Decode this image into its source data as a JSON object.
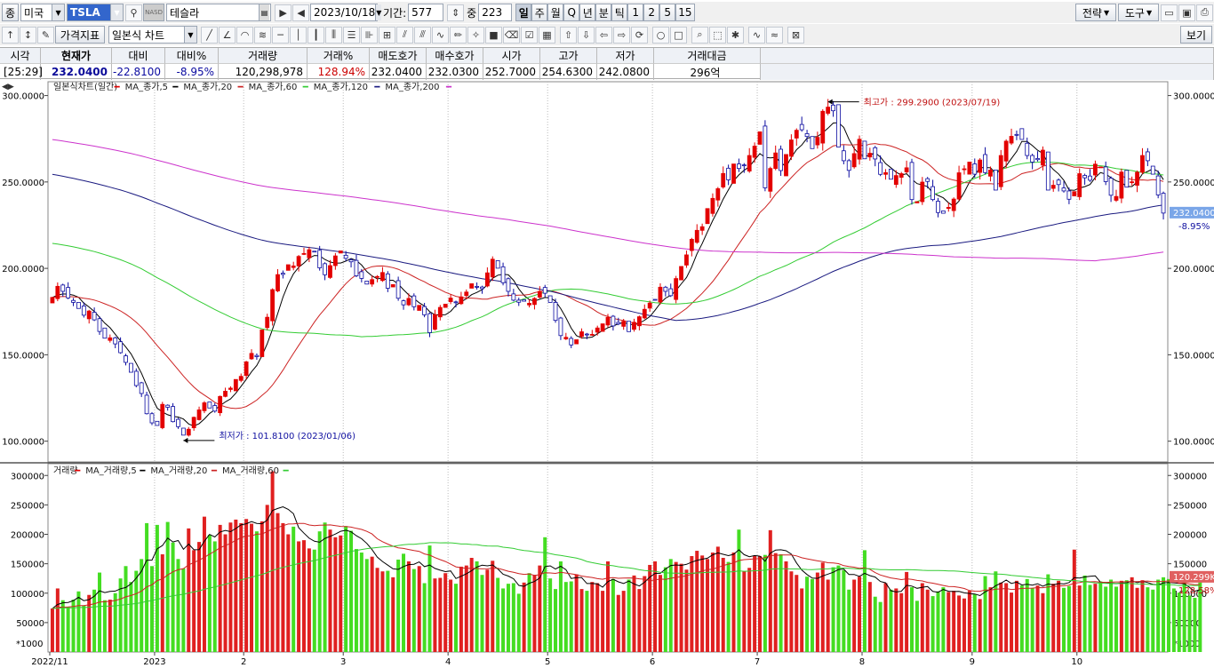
{
  "toolbar1": {
    "market_label": "종",
    "market": "미국",
    "ticker": "TSLA",
    "exchange_badge": "NASD",
    "name": "테슬라",
    "date": "2023/10/18",
    "period_label": "기간:",
    "period": "577",
    "zoom_label": "중",
    "zoom": "223",
    "intervals": [
      "일",
      "주",
      "월",
      "Q",
      "년",
      "분",
      "틱",
      "1",
      "2",
      "5",
      "15"
    ],
    "right": [
      "전략",
      "도구"
    ]
  },
  "toolbar2": {
    "indicator_btn": "가격지표",
    "chart_type": "일본식 차트",
    "view_btn": "보기"
  },
  "quote": {
    "headers": [
      "시각",
      "현재가",
      "대비",
      "대비%",
      "거래량",
      "거래%",
      "매도호가",
      "매수호가",
      "시가",
      "고가",
      "저가",
      "거래대금"
    ],
    "values": [
      "[25:29]",
      "232.0400",
      "-22.8100",
      "-8.95%",
      "120,298,978",
      "128.94%",
      "232.0400",
      "232.0300",
      "252.7000",
      "254.6300",
      "242.0800",
      "296억"
    ]
  },
  "price_panel": {
    "legend": [
      "일본식차트(일간)",
      "MA_종가,5",
      "MA_종가,20",
      "MA_종가,60",
      "MA_종가,120",
      "MA_종가,200"
    ],
    "high_note": "최고가 : 299.2900 (2023/07/19)",
    "low_note": "최저가 : 101.8100 (2023/01/06)",
    "last_price": "232.0400",
    "last_change": "-8.95%"
  },
  "volume_panel": {
    "legend": [
      "거래량",
      "MA_거래량,5",
      "MA_거래량,20",
      "MA_거래량,60"
    ],
    "last_volume": "120.299K",
    "last_ratio": "128.58%",
    "unit": "*1000"
  },
  "colors": {
    "up": "#e30000",
    "down": "#0a0aa0",
    "volume_up": "#e02020",
    "volume_down": "#44dd22",
    "ma5": "#000000",
    "ma20": "#cc2222",
    "ma60": "#33cc33",
    "ma120": "#1a1a80",
    "ma200": "#cc33cc"
  },
  "chart_data": [
    {
      "type": "candlestick",
      "title": "일본식차트(일간)",
      "x_labels": [
        "2022/11",
        "2023",
        "2",
        "3",
        "4",
        "5",
        "6",
        "7",
        "8",
        "9",
        "10"
      ],
      "y_ticks": [
        100,
        150,
        200,
        250,
        300
      ],
      "ylim": [
        88,
        308
      ],
      "series": [
        {
          "name": "TSLA daily close",
          "values": [
            183.2,
            189.6,
            186.7,
            182.9,
            180.3,
            176.8,
            172.9,
            175.3,
            170.2,
            163.5,
            159.6,
            159.8,
            156.3,
            151.2,
            145.6,
            139.9,
            132.2,
            127.6,
            115.9,
            110.6,
            109.1,
            121.3,
            119.6,
            111.3,
            108.4,
            103.5,
            106.9,
            113.8,
            118.1,
            122.2,
            119.2,
            117.4,
            125.9,
            128.9,
            130.7,
            135.7,
            137.5,
            145.9,
            150.8,
            148.9,
            164.4,
            171.7,
            187.7,
            196.4,
            196.5,
            202.1,
            201.4,
            206.9,
            208.6,
            210.8,
            209.6,
            200.3,
            196.3,
            201.6,
            207.2,
            210.1,
            205.8,
            203.8,
            195.7,
            194.2,
            190.9,
            193.5,
            195.3,
            197.6,
            188.5,
            190.6,
            182.7,
            178.9,
            182.6,
            177.8,
            178.6,
            173.1,
            162.8,
            173.3,
            177.4,
            179.3,
            182.8,
            180.3,
            183.5,
            186.3,
            191.1,
            189.2,
            188.3,
            197.4,
            205.3,
            200.1,
            191.7,
            186.7,
            181.6,
            180.4,
            181.0,
            179.8,
            182.6,
            186.7,
            185.6,
            180.3,
            169.9,
            161.1,
            160.1,
            155.7,
            158.7,
            163.3,
            161.6,
            161.8,
            165.5,
            167.9,
            171.6,
            166.7,
            167.8,
            169.4,
            163.4,
            168.8,
            172.0,
            176.3,
            179.9,
            182.0,
            189.1,
            186.7,
            184.2,
            194.1,
            201.1,
            207.8,
            216.8,
            222.0,
            224.1,
            234.6,
            240.5,
            246.1,
            254.9,
            251.2,
            260.4,
            257.8,
            259.4,
            265.3,
            270.7,
            279.0,
            246.6,
            257.8,
            266.8,
            256.6,
            265.9,
            274.3,
            279.9,
            280.2,
            276.3,
            269.3,
            275.8,
            290.9,
            293.3,
            291.2,
            270.2,
            262.3,
            256.7,
            266.4,
            274.7,
            263.4,
            266.6,
            263.3,
            254.4,
            255.4,
            251.6,
            253.7,
            254.8,
            258.2,
            239.8,
            238.6,
            249.9,
            250.3,
            239.8,
            232.3,
            231.9,
            235.3,
            240.1,
            255.3,
            257.6,
            261.5,
            254.5,
            262.7,
            255.4,
            256.9,
            245.3,
            265.3,
            273.6,
            276.4,
            277.5,
            274.6,
            265.3,
            261.5,
            262.9,
            268.4,
            245.3,
            248.1,
            248.5,
            244.8,
            240.0,
            244.4,
            254.8,
            252.4,
            251.0,
            260.3,
            258.7,
            250.2,
            242.3,
            241.6,
            255.7,
            247.0,
            250.1,
            255.6,
            265.3,
            262.3,
            254.5,
            242.5,
            232.0
          ]
        }
      ]
    },
    {
      "type": "bar",
      "title": "거래량",
      "y_ticks": [
        50000,
        100000,
        150000,
        200000,
        250000,
        300000
      ],
      "ylim": [
        0,
        320000
      ],
      "unit": "*1000",
      "series": [
        {
          "name": "거래량",
          "values": [
            74,
            108,
            88,
            77,
            89,
            103,
            79,
            97,
            106,
            135,
            88,
            89,
            100,
            125,
            146,
            119,
            138,
            158,
            219,
            146,
            216,
            166,
            221,
            186,
            158,
            142,
            210,
            173,
            187,
            230,
            199,
            188,
            216,
            200,
            220,
            225,
            219,
            226,
            218,
            205,
            222,
            250,
            307,
            236,
            219,
            200,
            213,
            188,
            190,
            176,
            174,
            205,
            220,
            208,
            195,
            198,
            214,
            206,
            175,
            169,
            158,
            162,
            143,
            137,
            138,
            127,
            157,
            167,
            154,
            141,
            146,
            117,
            181,
            125,
            126,
            134,
            123,
            116,
            145,
            147,
            160,
            154,
            131,
            140,
            155,
            126,
            108,
            116,
            117,
            99,
            118,
            134,
            131,
            147,
            195,
            125,
            107,
            154,
            119,
            120,
            132,
            107,
            104,
            119,
            117,
            104,
            154,
            124,
            97,
            104,
            123,
            130,
            107,
            129,
            148,
            154,
            131,
            144,
            158,
            153,
            150,
            140,
            163,
            172,
            164,
            158,
            169,
            179,
            160,
            153,
            169,
            208,
            137,
            143,
            163,
            163,
            165,
            207,
            168,
            166,
            154,
            137,
            131,
            108,
            128,
            124,
            135,
            152,
            123,
            144,
            147,
            139,
            106,
            123,
            128,
            173,
            119,
            94,
            85,
            117,
            106,
            108,
            100,
            136,
            110,
            87,
            117,
            106,
            95,
            103,
            110,
            102,
            104,
            96,
            91,
            104,
            98,
            90,
            129,
            110,
            137,
            118,
            117,
            101,
            121,
            113,
            124,
            109,
            113,
            100,
            132,
            116,
            121,
            109,
            112,
            174,
            113,
            130,
            114,
            116,
            120,
            111,
            123,
            111,
            121,
            122,
            127,
            109,
            122,
            110,
            106,
            123,
            127,
            124,
            108,
            101,
            120,
            96,
            92,
            120
          ]
        }
      ]
    }
  ]
}
